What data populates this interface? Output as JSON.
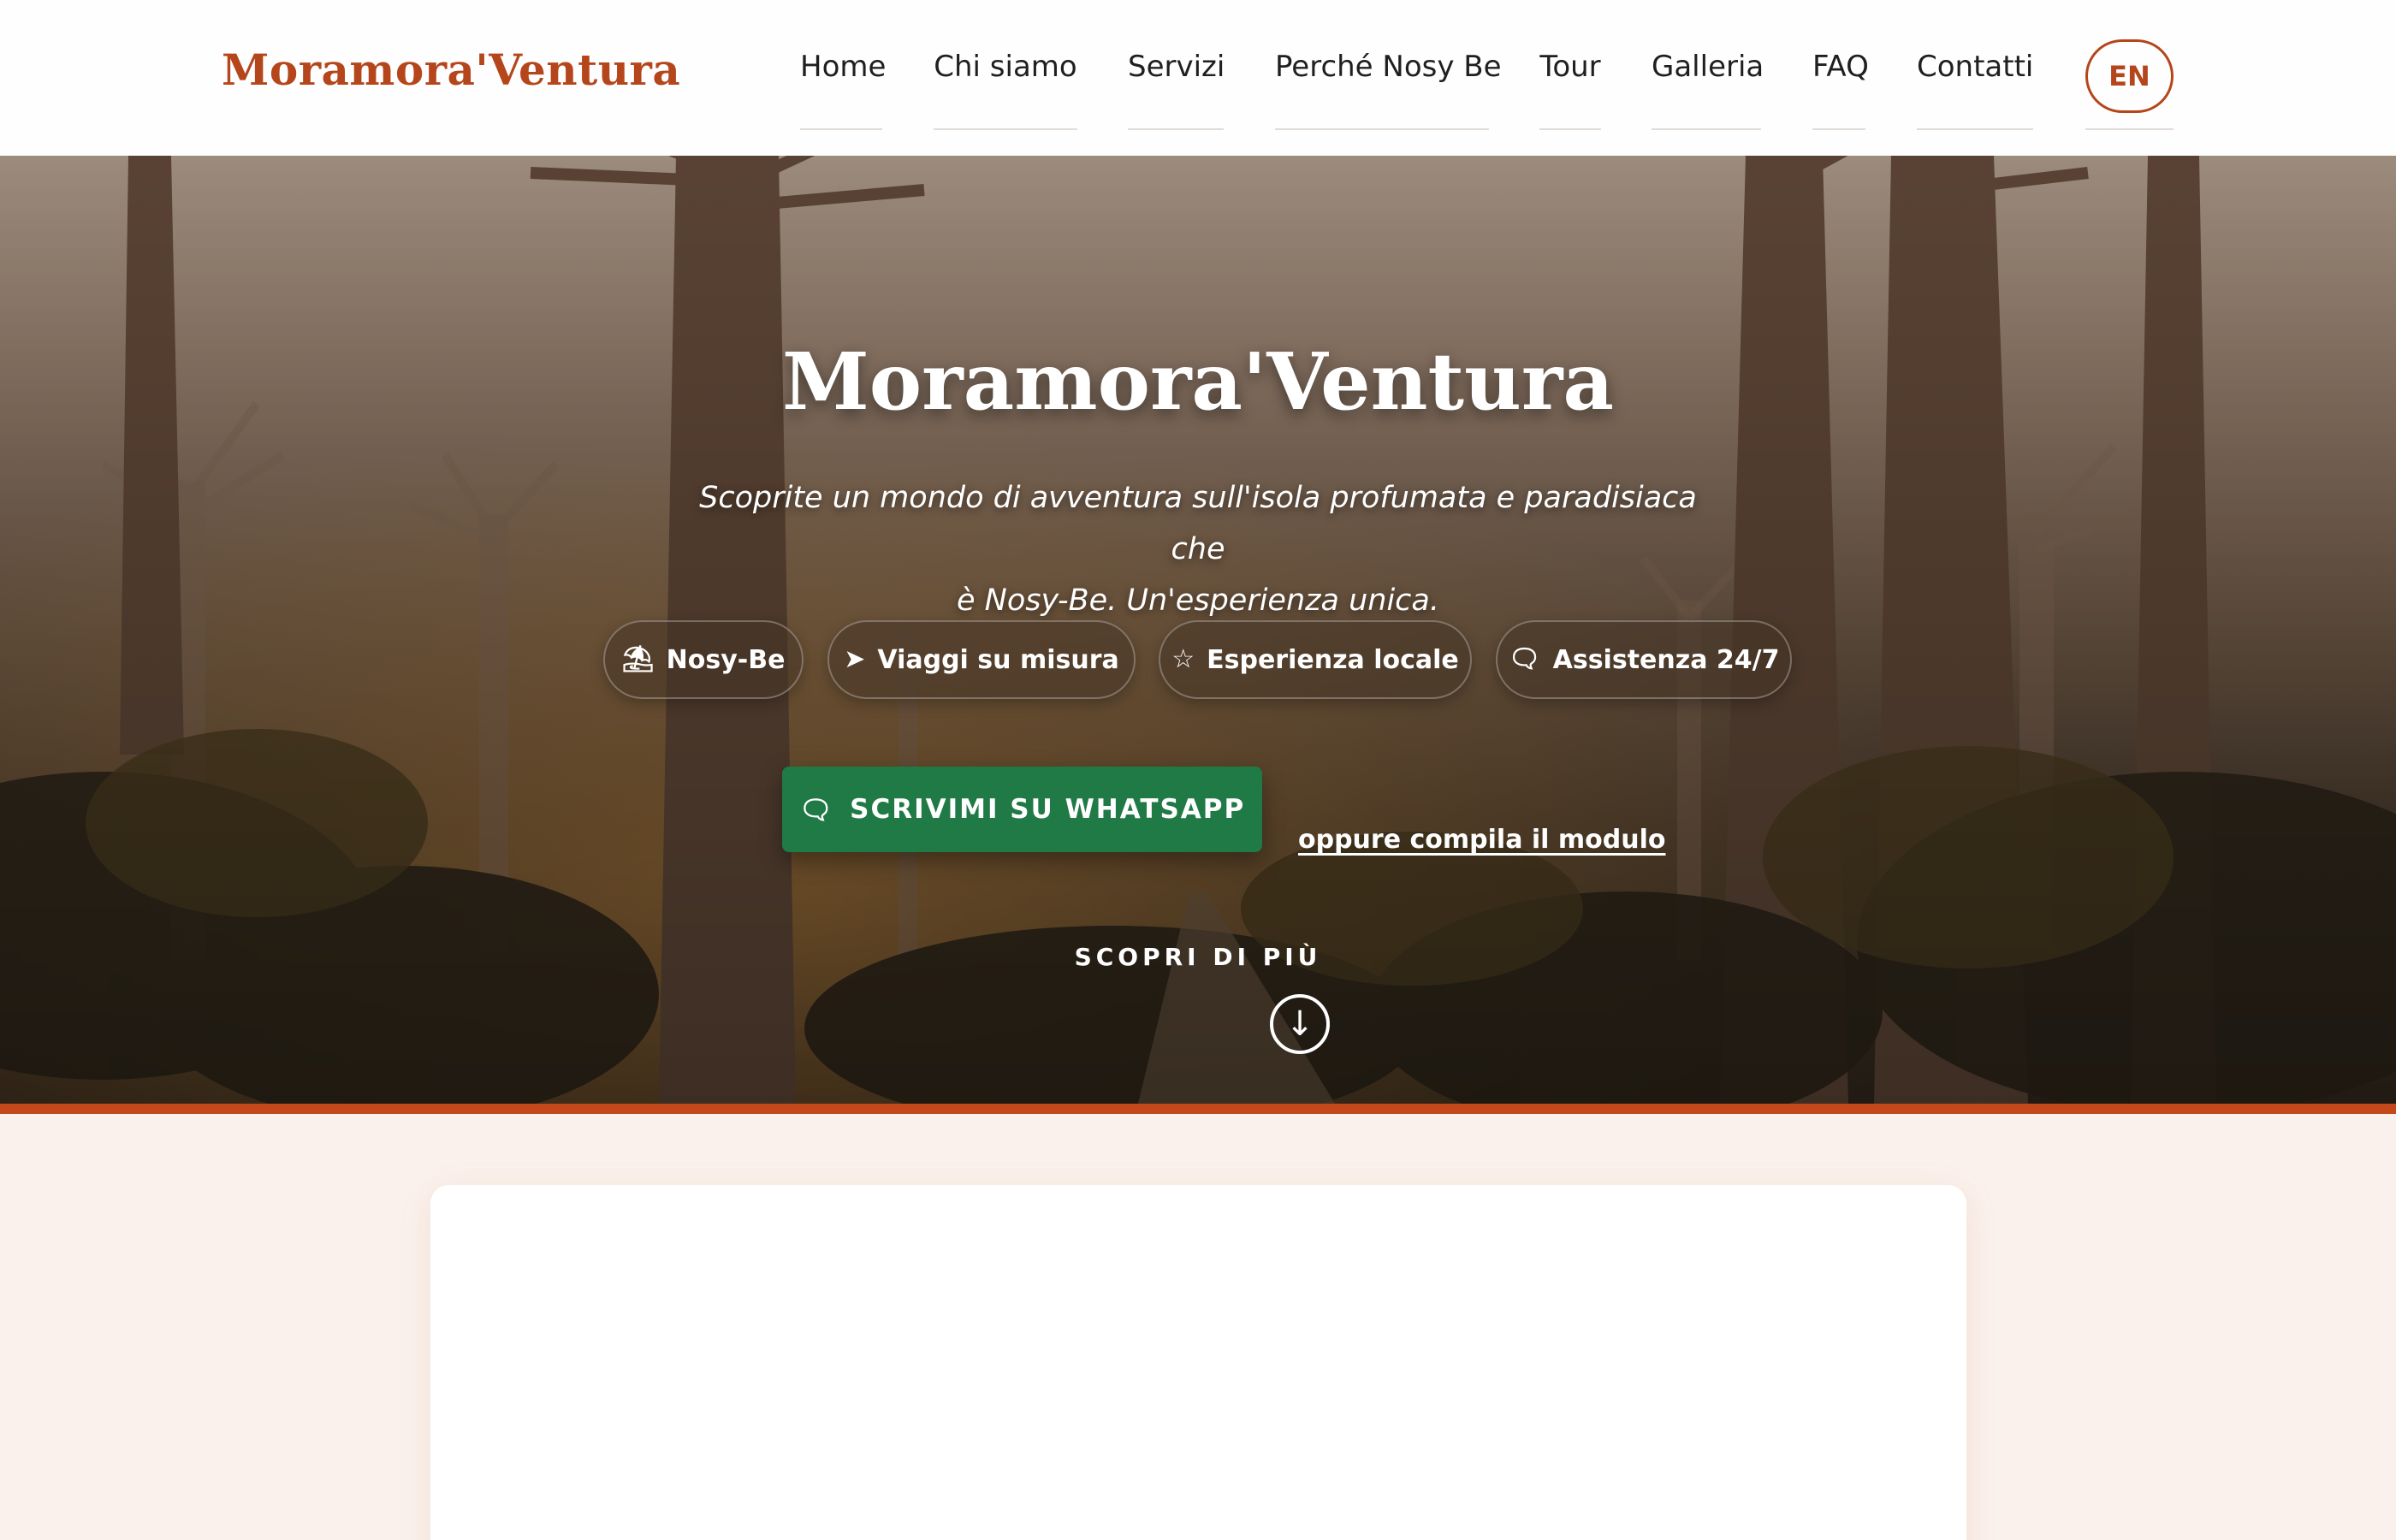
{
  "header": {
    "brand": "Moramora'Ventura",
    "nav": [
      "Home",
      "Chi siamo",
      "Servizi",
      "Perché Nosy Be",
      "Tour",
      "Galleria",
      "FAQ",
      "Contatti"
    ],
    "lang_button": "EN"
  },
  "hero": {
    "title": "Moramora'Ventura",
    "subtitle_line1": "Scoprite un mondo di avventura sull'isola profumata e paradisiaca che",
    "subtitle_line2": "è Nosy-Be. Un'esperienza unica.",
    "features": [
      {
        "icon": "beach-umbrella-icon",
        "label": "Nosy-Be"
      },
      {
        "icon": "navigation-arrow-icon",
        "label": "Viaggi su misura"
      },
      {
        "icon": "star-icon",
        "label": "Esperienza locale"
      },
      {
        "icon": "chat-bubble-icon",
        "label": "Assistenza 24/7"
      }
    ],
    "whatsapp_button": "SCRIVIMI SU WHATSAPP",
    "form_link": "oppure compila il modulo",
    "discover_label": "SCOPRI DI PIÙ"
  },
  "colors": {
    "brand": "#b5461b",
    "whatsapp": "#1f7a45",
    "accent_bar": "#c4491a",
    "page_background": "#fbf1ec"
  }
}
